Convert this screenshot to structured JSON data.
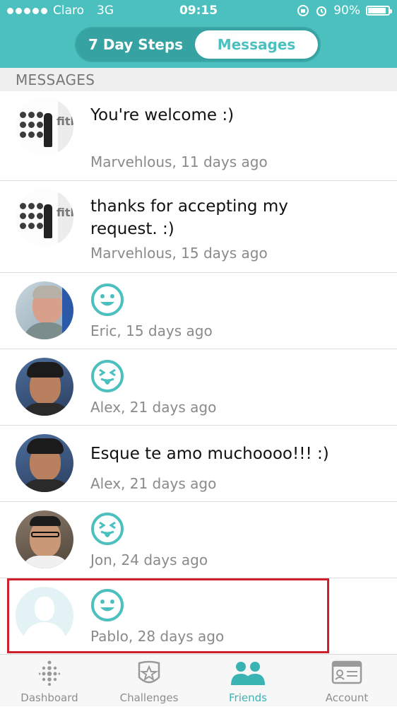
{
  "status_bar": {
    "carrier": "Claro",
    "network": "3G",
    "time": "09:15",
    "battery": "90%",
    "battery_level": 0.9
  },
  "segmented": {
    "tab1": "7 Day Steps",
    "tab2": "Messages",
    "selected": "Messages"
  },
  "section_title": "MESSAGES",
  "messages": [
    {
      "avatar": "fitbit-photo",
      "text": "You're welcome :)",
      "meta": "Marvehlous, 11 days ago"
    },
    {
      "avatar": "fitbit-photo",
      "text": "thanks for accepting my request. :)",
      "meta": "Marvehlous, 15 days ago"
    },
    {
      "avatar": "eric-photo",
      "emoji": "smile-emoji-icon",
      "meta": "Eric, 15 days ago"
    },
    {
      "avatar": "alex-photo",
      "emoji": "tongue-emoji-icon",
      "meta": "Alex, 21 days ago"
    },
    {
      "avatar": "alex-photo",
      "text": "Esque te amo muchoooo!!! :)",
      "meta": "Alex, 21 days ago"
    },
    {
      "avatar": "jon-photo",
      "emoji": "tongue-emoji-icon",
      "meta": "Jon, 24 days ago"
    },
    {
      "avatar": "default-avatar",
      "emoji": "smile-emoji-icon",
      "meta": "Pablo, 28 days ago"
    }
  ],
  "tabbar": {
    "items": [
      {
        "label": "Dashboard",
        "icon": "dashboard-dots-icon"
      },
      {
        "label": "Challenges",
        "icon": "challenges-badge-icon"
      },
      {
        "label": "Friends",
        "icon": "friends-icon"
      },
      {
        "label": "Account",
        "icon": "account-card-icon"
      }
    ],
    "active": "Friends"
  },
  "colors": {
    "brand_teal": "#4cc0bf",
    "highlight_red": "#d0202d"
  }
}
